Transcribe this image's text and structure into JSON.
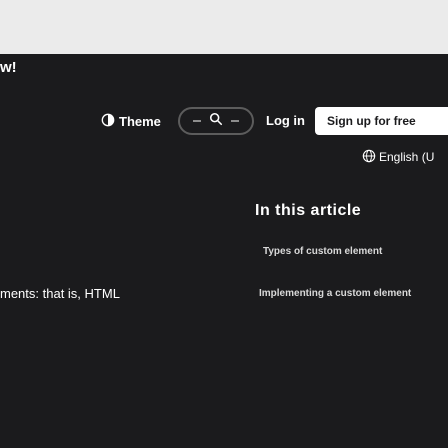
{
  "headline": {
    "fragment": "w!"
  },
  "navbar": {
    "theme_label": "Theme",
    "login_label": "Log in",
    "signup_label": "Sign up for free"
  },
  "language": {
    "selected": "English (U"
  },
  "toc": {
    "title": "In this article",
    "items": [
      {
        "label": "Types of custom element"
      },
      {
        "label": "Implementing a custom element"
      }
    ]
  },
  "body": {
    "fragment": "ments: that is, HTML"
  },
  "icons": {
    "theme": "contrast-circle-icon",
    "search": "search-icon",
    "globe": "globe-icon"
  },
  "colors": {
    "background": "#1b1b1d",
    "top_band": "#ebebeb",
    "signup_bg": "#ffffff"
  }
}
